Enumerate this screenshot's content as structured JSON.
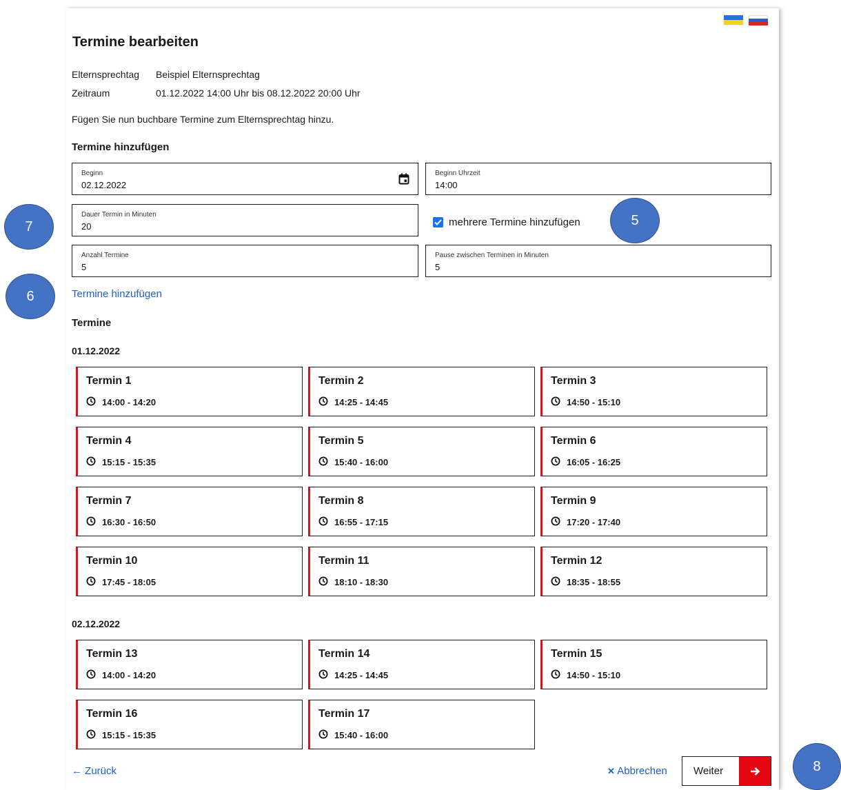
{
  "title": "Termine bearbeiten",
  "info": {
    "label_1": "Elternsprechtag",
    "value_1": "Beispiel Elternsprechtag",
    "label_2": "Zeitraum",
    "value_2": "01.12.2022 14:00 Uhr bis 08.12.2022 20:00 Uhr"
  },
  "intro": "Fügen Sie nun buchbare Termine zum Elternsprechtag hinzu.",
  "form": {
    "heading": "Termine hinzufügen",
    "begin_label": "Beginn",
    "begin_value": "02.12.2022",
    "begin_time_label": "Beginn Uhrzeit",
    "begin_time_value": "14:00",
    "duration_label": "Dauer Termin in Minuten",
    "duration_value": "20",
    "multiple_label": "mehrere Termine hinzufügen",
    "multiple_checked": true,
    "count_label": "Anzahl Termine",
    "count_value": "5",
    "pause_label": "Pause zwischen Terminen in Minuten",
    "pause_value": "5",
    "add_link": "Termine hinzufügen"
  },
  "appointments_heading": "Termine",
  "days": [
    {
      "date": "01.12.2022",
      "appointments": [
        {
          "title": "Termin 1",
          "time": "14:00 - 14:20"
        },
        {
          "title": "Termin 2",
          "time": "14:25 - 14:45"
        },
        {
          "title": "Termin 3",
          "time": "14:50 - 15:10"
        },
        {
          "title": "Termin 4",
          "time": "15:15 - 15:35"
        },
        {
          "title": "Termin 5",
          "time": "15:40 - 16:00"
        },
        {
          "title": "Termin 6",
          "time": "16:05 - 16:25"
        },
        {
          "title": "Termin 7",
          "time": "16:30 - 16:50"
        },
        {
          "title": "Termin 8",
          "time": "16:55 - 17:15"
        },
        {
          "title": "Termin 9",
          "time": "17:20 - 17:40"
        },
        {
          "title": "Termin 10",
          "time": "17:45 - 18:05"
        },
        {
          "title": "Termin 11",
          "time": "18:10 - 18:30"
        },
        {
          "title": "Termin 12",
          "time": "18:35 - 18:55"
        }
      ]
    },
    {
      "date": "02.12.2022",
      "appointments": [
        {
          "title": "Termin 13",
          "time": "14:00 - 14:20"
        },
        {
          "title": "Termin 14",
          "time": "14:25 - 14:45"
        },
        {
          "title": "Termin 15",
          "time": "14:50 - 15:10"
        },
        {
          "title": "Termin 16",
          "time": "15:15 - 15:35"
        },
        {
          "title": "Termin 17",
          "time": "15:40 - 16:00"
        }
      ]
    }
  ],
  "footer": {
    "back": "← Zurück",
    "cancel": "Abbrechen",
    "next": "Weiter"
  },
  "callouts": {
    "c5": "5",
    "c6": "6",
    "c7": "7",
    "c8": "8"
  },
  "colors": {
    "accent_red": "#e30613",
    "link_blue": "#1a5fd0",
    "callout_blue": "#4472c4",
    "checkbox_blue": "#1a73e8"
  },
  "icons": {
    "calendar": "calendar-icon",
    "clock": "clock-icon",
    "checkbox": "checkmark-icon",
    "cancel": "close-icon",
    "next": "arrow-right-icon",
    "flags": [
      "flag-ukraine-icon",
      "flag-russia-icon"
    ]
  }
}
